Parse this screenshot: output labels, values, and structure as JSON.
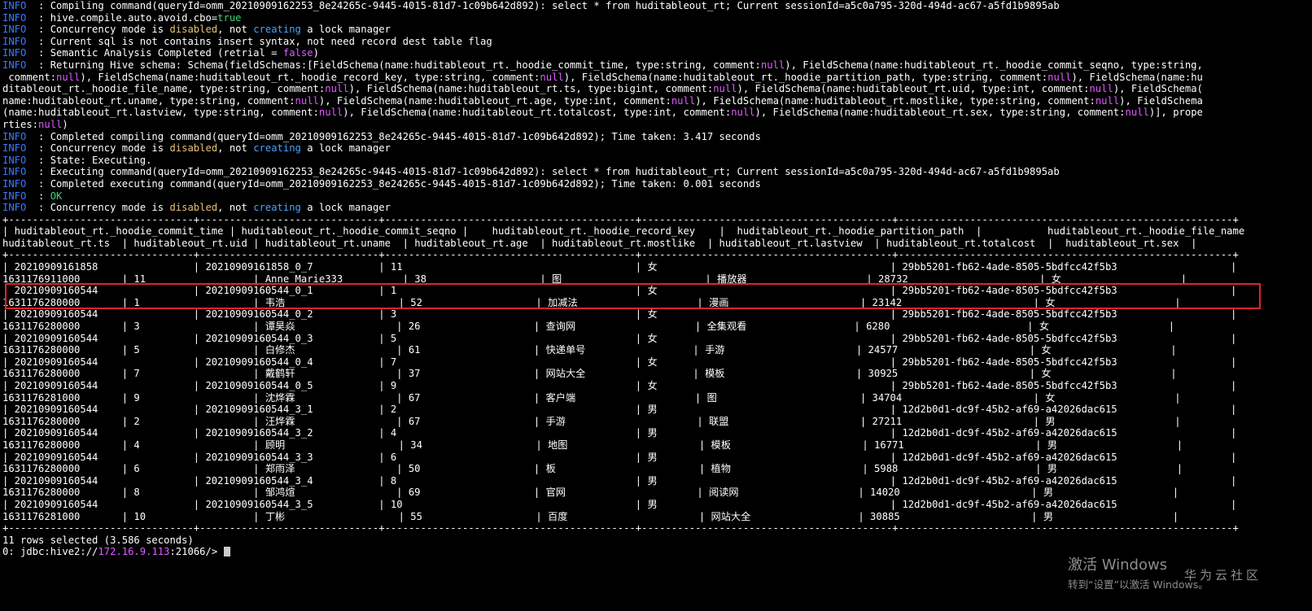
{
  "log_lines": [
    {
      "level": "INFO ",
      "text": " : Compiling command(queryId=omm_20210909162253_8e24265c-9445-4015-81d7-1c09b642d892): select * from huditableout_rt; Current sessionId=a5c0a795-320d-494d-ac67-a5fd1b9895ab"
    },
    {
      "level": "INFO ",
      "text": " : hive.compile.auto.avoid.cbo=true"
    },
    {
      "level": "INFO ",
      "text": " : Concurrency mode is disabled, not creating a lock manager"
    },
    {
      "level": "INFO ",
      "text": " : Current sql is not contains insert syntax, not need record dest table flag"
    },
    {
      "level": "INFO ",
      "text": " : Semantic Analysis Completed (retrial = false)"
    },
    {
      "level": "INFO ",
      "text": " : Returning Hive schema: Schema(fieldSchemas:[FieldSchema(name:huditableout_rt._hoodie_commit_time, type:string, comment:null), FieldSchema(name:huditableout_rt._hoodie_commit_seqno, type:string,"
    },
    {
      "level": "",
      "text": " comment:null), FieldSchema(name:huditableout_rt._hoodie_record_key, type:string, comment:null), FieldSchema(name:huditableout_rt._hoodie_partition_path, type:string, comment:null), FieldSchema(name:hu"
    },
    {
      "level": "",
      "text": "ditableout_rt._hoodie_file_name, type:string, comment:null), FieldSchema(name:huditableout_rt.ts, type:bigint, comment:null), FieldSchema(name:huditableout_rt.uid, type:int, comment:null), FieldSchema("
    },
    {
      "level": "",
      "text": "name:huditableout_rt.uname, type:string, comment:null), FieldSchema(name:huditableout_rt.age, type:int, comment:null), FieldSchema(name:huditableout_rt.mostlike, type:string, comment:null), FieldSchema"
    },
    {
      "level": "",
      "text": "(name:huditableout_rt.lastview, type:string, comment:null), FieldSchema(name:huditableout_rt.totalcost, type:int, comment:null), FieldSchema(name:huditableout_rt.sex, type:string, comment:null)], prope"
    },
    {
      "level": "",
      "text": "rties:null)"
    },
    {
      "level": "INFO ",
      "text": " : Completed compiling command(queryId=omm_20210909162253_8e24265c-9445-4015-81d7-1c09b642d892); Time taken: 3.417 seconds"
    },
    {
      "level": "INFO ",
      "text": " : Concurrency mode is disabled, not creating a lock manager"
    },
    {
      "level": "INFO ",
      "text": " : State: Executing."
    },
    {
      "level": "INFO ",
      "text": " : Executing command(queryId=omm_20210909162253_8e24265c-9445-4015-81d7-1c09b642d892): select * from huditableout_rt; Current sessionId=a5c0a795-320d-494d-ac67-a5fd1b9895ab"
    },
    {
      "level": "INFO ",
      "text": " : Completed executing command(queryId=omm_20210909162253_8e24265c-9445-4015-81d7-1c09b642d892); Time taken: 0.001 seconds"
    },
    {
      "level": "INFO ",
      "text": " : OK"
    },
    {
      "level": "INFO ",
      "text": " : Concurrency mode is disabled, not creating a lock manager"
    }
  ],
  "table": {
    "border": "+-------------------------------+------------------------------+-------------------------------------------+-------------------------------------------+--------------------------------------------------------+",
    "headers": [
      "huditableout_rt._hoodie_commit_time",
      "huditableout_rt._hoodie_commit_seqno",
      "huditableout_rt._hoodie_record_key",
      "huditableout_rt._hoodie_partition_path",
      "huditableout_rt._hoodie_file_name",
      "huditableout_rt.ts",
      "huditableout_rt.uid",
      "huditableout_rt.uname",
      "huditableout_rt.age",
      "huditableout_rt.mostlike",
      "huditableout_rt.lastview",
      "huditableout_rt.totalcost",
      "huditableout_rt.sex"
    ],
    "rows": [
      [
        "20210909161858",
        "20210909161858_0_7",
        "11",
        "女",
        "29bb5201-fb62-4ade-8505-5bdfcc42f5b3",
        "1631176911000",
        "11",
        "Anne Marie333",
        "38",
        "图",
        "播放器",
        "28732",
        "女"
      ],
      [
        "20210909160544",
        "20210909160544_0_1",
        "1",
        "女",
        "29bb5201-fb62-4ade-8505-5bdfcc42f5b3",
        "1631176280000",
        "1",
        "韦浩",
        "52",
        "加减法",
        "漫画",
        "23142",
        "女"
      ],
      [
        "20210909160544",
        "20210909160544_0_2",
        "3",
        "女",
        "29bb5201-fb62-4ade-8505-5bdfcc42f5b3",
        "1631176280000",
        "3",
        "谭昊焱",
        "26",
        "查询网",
        "全集观看",
        "6280",
        "女"
      ],
      [
        "20210909160544",
        "20210909160544_0_3",
        "5",
        "女",
        "29bb5201-fb62-4ade-8505-5bdfcc42f5b3",
        "1631176280000",
        "5",
        "白修杰",
        "61",
        "快递单号",
        "手游",
        "24577",
        "女"
      ],
      [
        "20210909160544",
        "20210909160544_0_4",
        "7",
        "女",
        "29bb5201-fb62-4ade-8505-5bdfcc42f5b3",
        "1631176280000",
        "7",
        "戴鹤轩",
        "37",
        "网站大全",
        "模板",
        "30925",
        "女"
      ],
      [
        "20210909160544",
        "20210909160544_0_5",
        "9",
        "女",
        "29bb5201-fb62-4ade-8505-5bdfcc42f5b3",
        "1631176281000",
        "9",
        "沈烨霖",
        "67",
        "客户端",
        "图",
        "34704",
        "女"
      ],
      [
        "20210909160544",
        "20210909160544_3_1",
        "2",
        "男",
        "12d2b0d1-dc9f-45b2-af69-a42026dac615",
        "1631176280000",
        "2",
        "汪烨霖",
        "67",
        "手游",
        "联盟",
        "27211",
        "男"
      ],
      [
        "20210909160544",
        "20210909160544_3_2",
        "4",
        "男",
        "12d2b0d1-dc9f-45b2-af69-a42026dac615",
        "1631176280000",
        "4",
        "顾明",
        "34",
        "地图",
        "模板",
        "16771",
        "男"
      ],
      [
        "20210909160544",
        "20210909160544_3_3",
        "6",
        "男",
        "12d2b0d1-dc9f-45b2-af69-a42026dac615",
        "1631176280000",
        "6",
        "郑雨泽",
        "50",
        "板",
        "植物",
        "5988",
        "男"
      ],
      [
        "20210909160544",
        "20210909160544_3_4",
        "8",
        "男",
        "12d2b0d1-dc9f-45b2-af69-a42026dac615",
        "1631176280000",
        "8",
        "邹鸿煊",
        "69",
        "官网",
        "阅读网",
        "14020",
        "男"
      ],
      [
        "20210909160544",
        "20210909160544_3_5",
        "10",
        "男",
        "12d2b0d1-dc9f-45b2-af69-a42026dac615",
        "1631176281000",
        "10",
        "丁彬",
        "55",
        "百度",
        "网站大全",
        "30885",
        "男"
      ]
    ]
  },
  "footer": {
    "rows_selected": "11 rows selected (3.586 seconds)",
    "prompt_prefix": "0: jdbc:hive2://",
    "prompt_ip": "172.16.9.113",
    "prompt_suffix": ":21066/> "
  },
  "watermark": {
    "title": "激活 Windows",
    "subtitle": "转到“设置”以激活 Windows。",
    "brand": "华为云社区"
  },
  "highlight_color": "#e3222b"
}
